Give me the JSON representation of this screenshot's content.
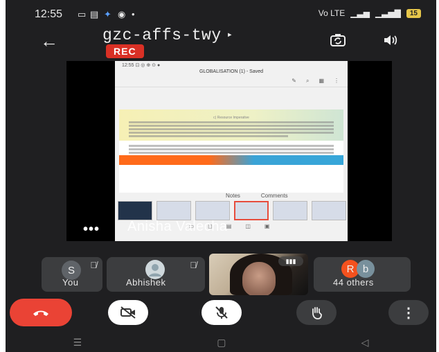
{
  "status_bar": {
    "time": "12:55",
    "network_left": "Vo LTE",
    "network_right": "ⁿⁱˡ",
    "battery": "15"
  },
  "header": {
    "meeting_code": "gzc-affs-twy",
    "recording_badge": "REC"
  },
  "presentation": {
    "presenter_name": "Anisha Valecha",
    "doc_status_bar": "12:55 ⊡ ◎ ⊕ ⊙ ●",
    "doc_title": "GLOBALISATION (1) - Saved",
    "doc_heading": "c) Resource Imperative",
    "notes_label": "Notes",
    "comments_label": "Comments"
  },
  "participants": [
    {
      "initial": "S",
      "label": "You",
      "avatar_color": "#5f6368"
    },
    {
      "label": "Abhishek"
    },
    {
      "label": "44 others",
      "initials": [
        "R",
        "b"
      ],
      "colors": [
        "#f4511e",
        "#78909c"
      ]
    }
  ],
  "colors": {
    "end_call": "#ea4335",
    "rec": "#d93025",
    "battery": "#e6c64a"
  }
}
